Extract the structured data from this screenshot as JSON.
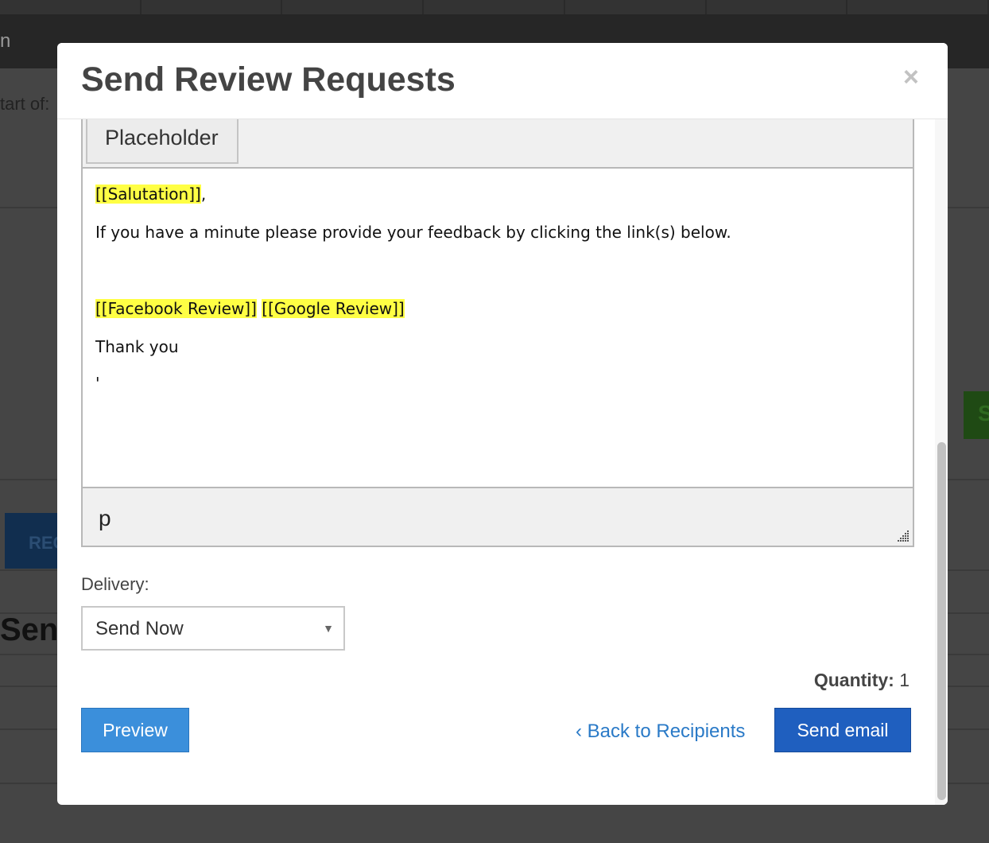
{
  "background": {
    "nav_fragment": "n",
    "start_label": "tart of:",
    "blue_button_fragment": "REC",
    "green_button_fragment": "S",
    "heading_fragment": "Sen"
  },
  "modal": {
    "title": "Send Review Requests",
    "close_symbol": "×",
    "editor": {
      "toolbar_button": "Placeholder",
      "salutation_tag": "[[Salutation]]",
      "salutation_suffix": ",",
      "body_text": "If you have a minute please provide your feedback by clicking the link(s) below.",
      "facebook_tag": "[[Facebook Review]]",
      "google_tag": "[[Google Review]]",
      "closing": "Thank you",
      "trailing": "'",
      "status_path": "p"
    },
    "delivery": {
      "label": "Delivery:",
      "selected": "Send Now"
    },
    "quantity": {
      "label": "Quantity:",
      "value": "1"
    },
    "buttons": {
      "preview": "Preview",
      "back": "‹ Back to Recipients",
      "send": "Send email"
    }
  },
  "colors": {
    "highlight": "#ffff44",
    "preview_button": "#3b8fdb",
    "send_button": "#1f5fbf",
    "link": "#2a7ac7"
  }
}
